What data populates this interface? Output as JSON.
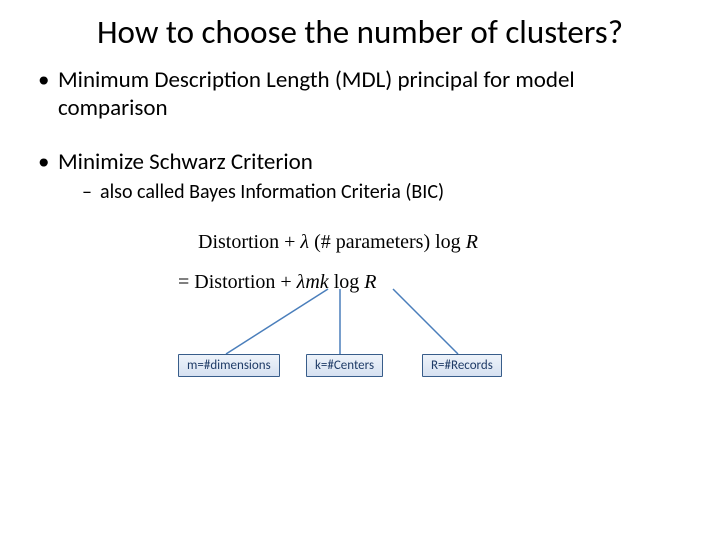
{
  "title": "How to choose the number of clusters?",
  "bullets": {
    "b1": "Minimum Description Length (MDL) principal for model comparison",
    "b2": "Minimize Schwarz Criterion",
    "b2_sub": "also called Bayes Information Criteria (BIC)"
  },
  "formula": {
    "line1_a": "Distortion + ",
    "line1_lambda": "λ",
    "line1_b": " (# parameters) log ",
    "line1_R": "R",
    "line2_eq": "= Distortion + ",
    "line2_lambda": "λ",
    "line2_m": "m",
    "line2_k": "k",
    "line2_log": " log ",
    "line2_R": "R"
  },
  "callouts": {
    "m": "m=#dimensions",
    "k": "k=#Centers",
    "R": "R=#Records"
  }
}
